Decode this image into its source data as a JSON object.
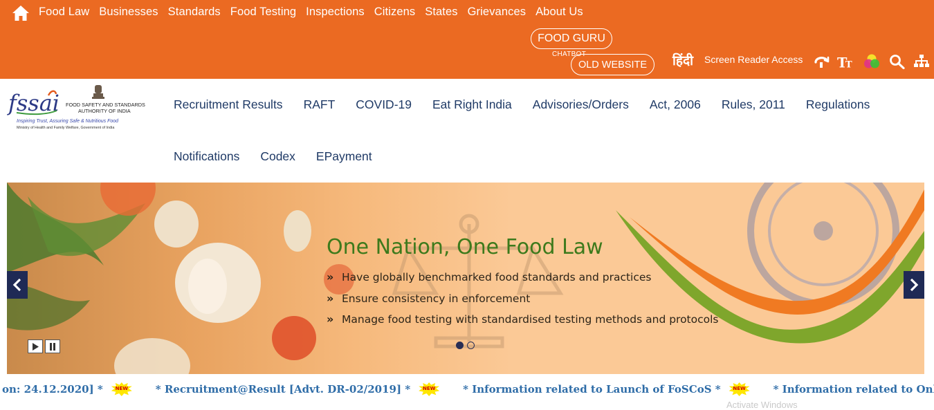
{
  "topnav": {
    "items": [
      "Food Law",
      "Businesses",
      "Standards",
      "Food Testing",
      "Inspections",
      "Citizens",
      "States",
      "Grievances",
      "About Us"
    ]
  },
  "top_right": {
    "food_guru": "FOOD GURU",
    "chatbot": "CHATBOT",
    "old_website": "OLD WEBSITE",
    "hindi": "हिंदी",
    "screen_reader": "Screen Reader Access",
    "icons": [
      "accessibility-icon",
      "text-size-icon",
      "color-contrast-icon",
      "search-icon",
      "sitemap-icon"
    ]
  },
  "logo": {
    "brand": "fssai",
    "org_line1": "FOOD SAFETY AND STANDARDS",
    "org_line2": "AUTHORITY OF INDIA",
    "tagline": "Inspiring Trust, Assuring Safe & Nutritious Food",
    "ministry": "Ministry of Health and Family Welfare, Government of India"
  },
  "mainnav": {
    "row1": [
      "Recruitment Results",
      "RAFT",
      "COVID-19",
      "Eat Right India",
      "Advisories/Orders",
      "Act, 2006",
      "Rules, 2011",
      "Regulations"
    ],
    "row2": [
      "Notifications",
      "Codex",
      "EPayment"
    ]
  },
  "banner": {
    "title": "One Nation, One Food Law",
    "points": [
      "Have globally benchmarked food standards and practices",
      "Ensure consistency in enforcement",
      "Manage food testing with standardised testing methods and protocols"
    ],
    "slide_count": 2,
    "active_slide": 1
  },
  "ticker": {
    "items": [
      "on: 24.12.2020] *",
      "* Recruitment@Result [Advt. DR-02/2019] *",
      "* Information related to Launch of FoSCoS *",
      "* Information related to Online Webinar / Virtual Training"
    ],
    "new_label": "NEW"
  },
  "overlay_text": "Activate Windows",
  "colors": {
    "topbar": "#eb6a22",
    "nav_text": "#1f3a66",
    "banner_title": "#3d7a1c",
    "ticker_text": "#2f6da8",
    "arrow_bg": "#1f2a55"
  }
}
